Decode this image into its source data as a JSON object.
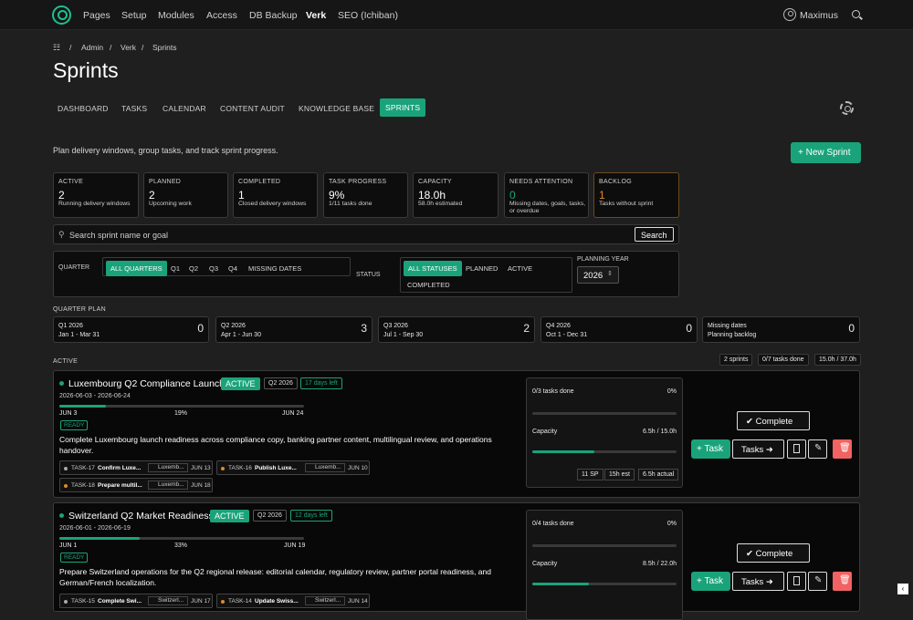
{
  "nav": {
    "items": [
      "Pages",
      "Setup",
      "Modules",
      "Access",
      "DB Backup",
      "Verk",
      "SEO (Ichiban)"
    ],
    "user": "Maximus"
  },
  "breadcrumb": [
    "Admin",
    "Verk",
    "Sprints"
  ],
  "page": {
    "title": "Sprints",
    "description": "Plan delivery windows, group tasks, and track sprint progress.",
    "new_sprint": "+ New Sprint"
  },
  "tabs": [
    "DASHBOARD",
    "TASKS",
    "CALENDAR",
    "CONTENT AUDIT",
    "KNOWLEDGE BASE",
    "SPRINTS"
  ],
  "stats": [
    {
      "title": "ACTIVE",
      "value": "2",
      "sub": "Running delivery windows"
    },
    {
      "title": "PLANNED",
      "value": "2",
      "sub": "Upcoming work"
    },
    {
      "title": "COMPLETED",
      "value": "1",
      "sub": "Closed delivery windows"
    },
    {
      "title": "TASK PROGRESS",
      "value": "9%",
      "sub": "1/11 tasks done"
    },
    {
      "title": "CAPACITY",
      "value": "18.0h",
      "sub": "58.0h estimated"
    },
    {
      "title": "NEEDS ATTENTION",
      "value": "0",
      "sub": "Missing dates, goals, tasks, or overdue"
    },
    {
      "title": "BACKLOG",
      "value": "1",
      "sub": "Tasks without sprint"
    }
  ],
  "search": {
    "placeholder": "Search sprint name or goal",
    "button": "Search"
  },
  "filters": {
    "quarter_label": "QUARTER",
    "quarters": [
      "ALL QUARTERS",
      "Q1",
      "Q2",
      "Q3",
      "Q4",
      "MISSING DATES"
    ],
    "status_label": "STATUS",
    "statuses": [
      "ALL STATUSES",
      "PLANNED",
      "ACTIVE",
      "COMPLETED"
    ],
    "year_label": "PLANNING YEAR",
    "year": "2026"
  },
  "quarter_plan": {
    "label": "QUARTER PLAN",
    "items": [
      {
        "name": "Q1 2026",
        "range": "Jan 1 - Mar 31",
        "count": "0"
      },
      {
        "name": "Q2 2026",
        "range": "Apr 1 - Jun 30",
        "count": "3"
      },
      {
        "name": "Q3 2026",
        "range": "Jul 1 - Sep 30",
        "count": "2"
      },
      {
        "name": "Q4 2026",
        "range": "Oct 1 - Dec 31",
        "count": "0"
      },
      {
        "name": "Missing dates",
        "range": "Planning backlog",
        "count": "0"
      }
    ]
  },
  "active_section": {
    "label": "ACTIVE",
    "summary": [
      "2 sprints",
      "0/7 tasks done",
      "15.0h / 37.0h"
    ]
  },
  "sprints": [
    {
      "title": "Luxembourg Q2 Compliance Launch",
      "status": "ACTIVE",
      "quarter": "Q2 2026",
      "days_left": "17 days left",
      "dates": "2026-06-03 - 2026-06-24",
      "start": "JUN 3",
      "end": "JUN 24",
      "percent": "19%",
      "progress": 0.19,
      "ready": "READY",
      "goal": "Complete Luxembourg launch readiness across compliance copy, banking partner content, multilingual review, and operations handover.",
      "tasks": [
        {
          "id": "TASK-17",
          "name": "Confirm Luxe...",
          "page": "Luxemb...",
          "date": "JUN 13",
          "dot": "#aaaaaa"
        },
        {
          "id": "TASK-16",
          "name": "Publish Luxe...",
          "page": "Luxemb...",
          "date": "JUN 10",
          "dot": "#e08a2a"
        },
        {
          "id": "TASK-18",
          "name": "Prepare multil...",
          "page": "Luxemb...",
          "date": "JUN 18",
          "dot": "#e08a2a"
        }
      ],
      "tasks_done": "0/3 tasks done",
      "tasks_pct": "0%",
      "capacity_label": "Capacity",
      "capacity": "6.5h / 15.0h",
      "capacity_ratio": 0.43,
      "chips": [
        "11 SP",
        "15h est",
        "6.5h actual"
      ],
      "buttons": {
        "complete": "Complete",
        "task": "Task",
        "tasks": "Tasks"
      }
    },
    {
      "title": "Switzerland Q2 Market Readiness",
      "status": "ACTIVE",
      "quarter": "Q2 2026",
      "days_left": "12 days left",
      "dates": "2026-06-01 - 2026-06-19",
      "start": "JUN 1",
      "end": "JUN 19",
      "percent": "33%",
      "progress": 0.33,
      "ready": "READY",
      "goal": "Prepare Switzerland operations for the Q2 regional release: editorial calendar, regulatory review, partner portal readiness, and German/French localization.",
      "tasks": [
        {
          "id": "TASK-15",
          "name": "Complete Swi...",
          "page": "Switzerl...",
          "date": "JUN 17",
          "dot": "#aaaaaa"
        },
        {
          "id": "TASK-14",
          "name": "Update Swiss...",
          "page": "Switzerl...",
          "date": "JUN 14",
          "dot": "#e08a2a"
        }
      ],
      "tasks_done": "0/4 tasks done",
      "tasks_pct": "0%",
      "capacity_label": "Capacity",
      "capacity": "8.5h / 22.0h",
      "capacity_ratio": 0.39,
      "buttons": {
        "complete": "Complete",
        "task": "Task",
        "tasks": "Tasks"
      }
    }
  ],
  "colors": {
    "accent": "#1aa37a",
    "danger": "#f25c5c",
    "warning": "#e08a2a"
  }
}
